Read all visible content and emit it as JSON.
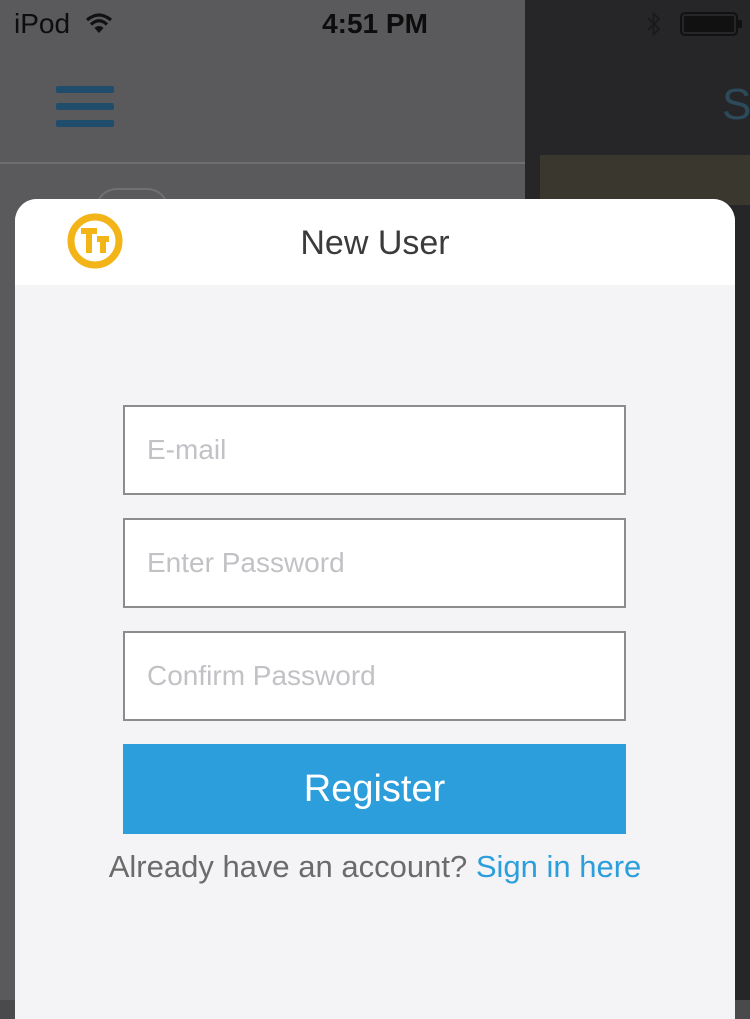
{
  "status_bar": {
    "carrier": "iPod",
    "time": "4:51 PM"
  },
  "modal": {
    "title": "New User",
    "fields": {
      "email_placeholder": "E-mail",
      "password_placeholder": "Enter Password",
      "confirm_placeholder": "Confirm Password"
    },
    "register_label": "Register",
    "signin_prompt": "Already have an account?",
    "signin_link": "Sign in here"
  },
  "icons": {
    "menu": "hamburger-menu-icon",
    "logo": "app-logo-icon",
    "wifi": "wifi-icon",
    "bluetooth": "bluetooth-icon",
    "battery": "battery-icon"
  },
  "colors": {
    "accent": "#2b9edb",
    "logo": "#f2b417",
    "overlay": "#5a595c"
  }
}
